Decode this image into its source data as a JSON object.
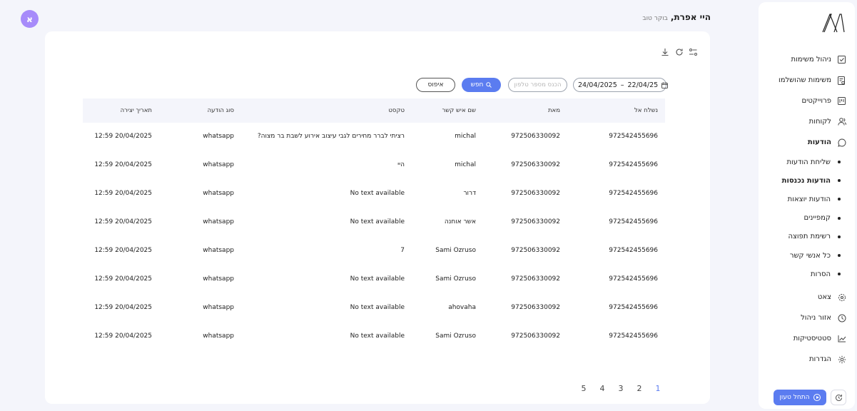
{
  "header": {
    "greeting_name": "היי אפרת,",
    "greeting_sub": "בוקר טוב",
    "avatar_letter": "א"
  },
  "sidebar": {
    "items": [
      {
        "label": "ניהול משימות",
        "icon": "task-check-icon"
      },
      {
        "label": "משימות שהושלמו",
        "icon": "completed-doc-icon"
      },
      {
        "label": "פרוייקטים",
        "icon": "projects-icon"
      },
      {
        "label": "לקוחות",
        "icon": "users-icon"
      },
      {
        "label": "הודעות",
        "icon": "message-icon"
      }
    ],
    "sub_items": [
      {
        "label": "שליחת הודעות"
      },
      {
        "label": "הודעות נכנסות"
      },
      {
        "label": "הודעות יוצאות"
      },
      {
        "label": "קמפיינים"
      },
      {
        "label": "רשימת תפוצה"
      },
      {
        "label": "כל אנשי קשר"
      },
      {
        "label": "הסרות"
      }
    ],
    "bottom_items": [
      {
        "label": "צאט",
        "icon": "bot-icon"
      },
      {
        "label": "אזור ניהול",
        "icon": "clock-icon"
      },
      {
        "label": "סטטיסטיקות",
        "icon": "chart-icon"
      },
      {
        "label": "הגדרות",
        "icon": "gear-icon"
      }
    ],
    "tour_button": "התחל טעון"
  },
  "filters": {
    "date_from": "24/04/2025",
    "date_to": "22/04/25",
    "date_separator": "–",
    "phone_placeholder": "הכנס מספר טלפון",
    "search_label": "חפש",
    "reset_label": "איפוס"
  },
  "table": {
    "headers": [
      "נשלח אל",
      "מאת",
      "שם איש קשר",
      "טקסט",
      "סוג הודעה",
      "תאריך יצירה"
    ],
    "rows": [
      [
        "972542455696",
        "972506330092",
        "michal",
        "רציתי לברר מחירים לגבי עיצוב אירוע לשבת בר מצוה?",
        "whatsapp",
        "20/04/2025 12:59"
      ],
      [
        "972542455696",
        "972506330092",
        "michal",
        "היי",
        "whatsapp",
        "20/04/2025 12:59"
      ],
      [
        "972542455696",
        "972506330092",
        "דרור",
        "No text available",
        "whatsapp",
        "20/04/2025 12:59"
      ],
      [
        "972542455696",
        "972506330092",
        "אשר אוחנה",
        "No text available",
        "whatsapp",
        "20/04/2025 12:59"
      ],
      [
        "972542455696",
        "972506330092",
        "Sami Ozruso",
        "7",
        "whatsapp",
        "20/04/2025 12:59"
      ],
      [
        "972542455696",
        "972506330092",
        "Sami Ozruso",
        "No text available",
        "whatsapp",
        "20/04/2025 12:59"
      ],
      [
        "972542455696",
        "972506330092",
        "ahovaha",
        "No text available",
        "whatsapp",
        "20/04/2025 12:59"
      ],
      [
        "972542455696",
        "972506330092",
        "Sami Ozruso",
        "No text available",
        "whatsapp",
        "20/04/2025 12:59"
      ]
    ]
  },
  "pagination": {
    "pages": [
      "1",
      "2",
      "3",
      "4",
      "5"
    ],
    "active": "1"
  },
  "colors": {
    "accent": "#5b7cf0",
    "avatar": "#a78bfa",
    "background": "#f4f5fb"
  }
}
